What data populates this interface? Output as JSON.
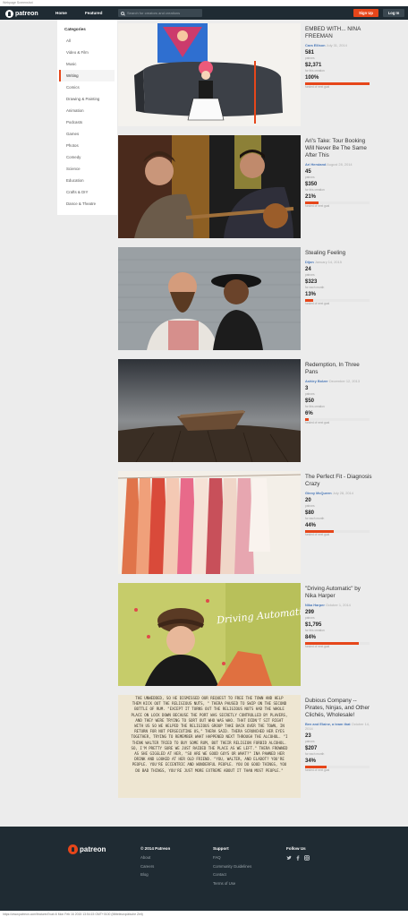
{
  "page_caption": "Webpage Screenshot",
  "header": {
    "logo_text": "patreon",
    "nav": [
      "Home",
      "Featured"
    ],
    "search_placeholder": "Search for creators and creations",
    "signup_label": "Sign Up",
    "login_label": "Log In"
  },
  "sidebar": {
    "title": "Categories",
    "items": [
      "All",
      "Video & Film",
      "Music",
      "Writing",
      "Comics",
      "Drawing & Painting",
      "Animation",
      "Podcasts",
      "Games",
      "Photos",
      "Comedy",
      "Science",
      "Education",
      "Crafts & DIY",
      "Dance & Theatre"
    ],
    "active_index": 3
  },
  "accent_color": "#e6461a",
  "cards": [
    {
      "title": "EMBED WITH... NINA FREEMAN",
      "creator": "Cara Ellison",
      "date": "July 31, 2014",
      "patrons": "581",
      "patrons_label": "patrons",
      "amount": "$2,371",
      "amount_label": "for this creation",
      "goal_pct": "100%",
      "goal_label": "funded of next goal",
      "progress": 1.0
    },
    {
      "title": "Ari's Take: Tour Booking Will Never Be The Same After This",
      "creator": "Ari Herstand",
      "date": "August 28, 2014",
      "patrons": "45",
      "patrons_label": "patrons",
      "amount": "$350",
      "amount_label": "for this creation",
      "goal_pct": "21%",
      "goal_label": "funded of next goal",
      "progress": 0.21
    },
    {
      "title": "Stealing Feeling",
      "creator": "Dijon",
      "date": "January 14, 2015",
      "patrons": "24",
      "patrons_label": "patrons",
      "amount": "$323",
      "amount_label": "for each month",
      "goal_pct": "13%",
      "goal_label": "funded of next goal",
      "progress": 0.13
    },
    {
      "title": "Redemption, In Three Pans",
      "creator": "Ashley Bolzer",
      "date": "December 12, 2013",
      "patrons": "3",
      "patrons_label": "patrons",
      "amount": "$50",
      "amount_label": "for this creation",
      "goal_pct": "6%",
      "goal_label": "funded of next goal",
      "progress": 0.06
    },
    {
      "title": "The Perfect Fit - Diagnosis Crazy",
      "creator": "Ginny McQueen",
      "date": "July 28, 2014",
      "patrons": "20",
      "patrons_label": "patrons",
      "amount": "$80",
      "amount_label": "for each month",
      "goal_pct": "44%",
      "goal_label": "funded of next goal",
      "progress": 0.44
    },
    {
      "title": "\"Driving Automatic\" by Nika Harper",
      "creator": "Nika Harper",
      "date": "October 1, 2014",
      "patrons": "299",
      "patrons_label": "patrons",
      "amount": "$1,795",
      "amount_label": "for this creation",
      "goal_pct": "84%",
      "goal_label": "funded of next goal",
      "progress": 0.84
    },
    {
      "title": "Dubious Company -- Pirates, Ninjas, and Other Clichés, Wholesale!",
      "creator": "Ben and Elaine, a team that",
      "date": "October 14, 2014",
      "patrons": "23",
      "patrons_label": "patrons",
      "amount": "$207",
      "amount_label": "for each month",
      "goal_pct": "34%",
      "goal_label": "funded of next goal",
      "progress": 0.34
    }
  ],
  "card6_image_text": "Driving Automatic",
  "card7_image_text": "THE UNWEDDED, SO HE DISMISSED OUR REQUEST TO FREE THE TOWN AND HELP THEM KICK OUT THE RELIGIOUS NUTS, \" THERA PAUSED TO SWIP ON THE SECOND BOTTLE OF RUM. \"EXCEPT IT TURNS OUT THE RELIGIOUS NUTS HAD THE WHOLE PLACE ON LOCK DOWN BECAUSE THE PORT WAS SECRETLY CONTROLLED BY PLAVERS, AND THEY WERE TRYING TO SORT OUT WHO WAS WHO. THAT DIDN'T SIT RIGHT WITH US SO WE HELPED THE RELIGIOUS GROUP TAKE BACK OVER THE TOWN, IN RETURN FOR NOT PERSECUTING US,\" THERA SAID. THERA SCRUNCHED HER EYES TOGETHER, TRYING TO REMEMBER WHAT HAPPENED NEXT THROUGH THE ALCOHOL. \"I THINK WALTER TRIED TO BUY SOME RUM, BUT THEIR RELIGION FORBID ALCOHOL. SO, I'M PRETTY SURE WE JUST RAIDED THE PLACE AS WE LEFT.\" THERA FROWNED AS SHE GIGGLED AT HER, \"SO ARE WE GOOD GUYS OR WHAT?\" INA PAWNED HER DRINK AND LOOKED AT HER OLD FRIEND. \"YOU, WALTER, AND ELADOT? YOU'RE PEOPLE. YOU'RE ECCENTRIC AND WONDERFUL PEOPLE. YOU DO GOOD THINGS, YOU DO BAD THINGS, YOU'RE JUST MORE EXTREME ABOUT IT THAN MOST PEOPLE.\"",
  "footer": {
    "logo_text": "patreon",
    "col1": {
      "head": "© 2014 Patreon",
      "links": [
        "About",
        "Careers",
        "Blog"
      ]
    },
    "col2": {
      "head": "Support",
      "links": [
        "FAQ",
        "Community Guidelines",
        "Contact",
        "Terms of Use"
      ]
    },
    "col3": {
      "head": "Follow Us",
      "icons": [
        "twitter-icon",
        "facebook-icon",
        "instagram-icon"
      ]
    }
  },
  "status_url": "https://www.patreon.com/featured?cat=6 Mon Feb 16 2015 13:54:15 GMT+0100 (Mitteleuropäische Zeit)"
}
